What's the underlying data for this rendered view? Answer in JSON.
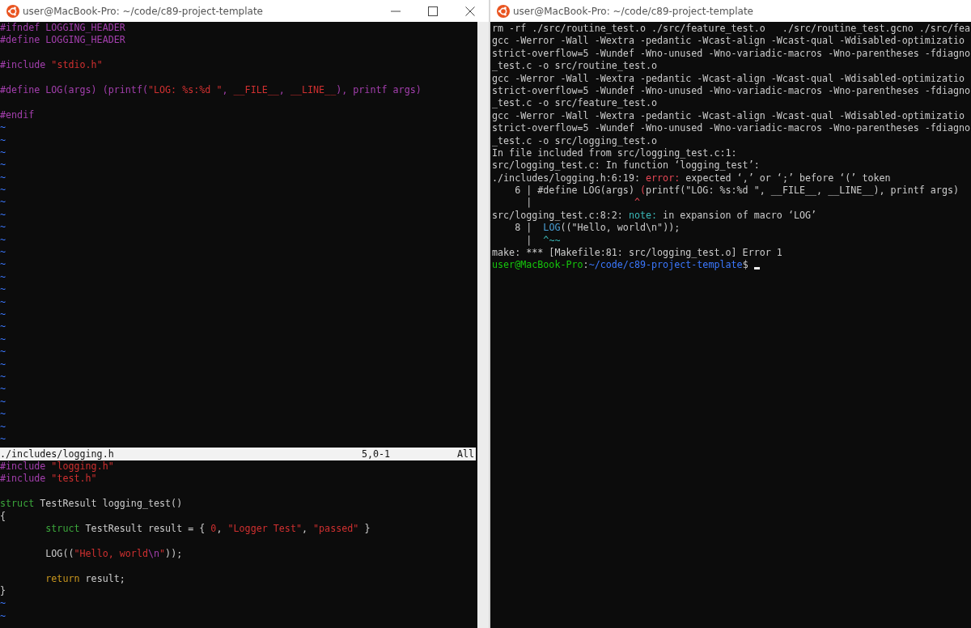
{
  "left_window": {
    "title": "user@MacBook-Pro: ~/code/c89-project-template",
    "controls": [
      {
        "kind": "minimize"
      },
      {
        "kind": "maximize"
      },
      {
        "kind": "close"
      }
    ],
    "vim": {
      "top_pane": {
        "lines": [
          {
            "kind": "code",
            "segments": [
              {
                "kind": "preproc",
                "text": "#ifndef LOGGING_HEADER"
              }
            ]
          },
          {
            "kind": "code",
            "segments": [
              {
                "kind": "preproc",
                "text": "#define LOGGING_HEADER"
              }
            ]
          },
          {
            "kind": "blank"
          },
          {
            "kind": "code",
            "segments": [
              {
                "kind": "preproc",
                "text": "#include "
              },
              {
                "kind": "string",
                "text": "\"stdio.h\""
              }
            ]
          },
          {
            "kind": "blank"
          },
          {
            "kind": "code",
            "segments": [
              {
                "kind": "preproc",
                "text": "#define LOG(args) (printf("
              },
              {
                "kind": "string",
                "text": "\"LOG: %s:%d \""
              },
              {
                "kind": "preproc",
                "text": ", "
              },
              {
                "kind": "string",
                "text": "__FILE__"
              },
              {
                "kind": "preproc",
                "text": ", "
              },
              {
                "kind": "string",
                "text": "__LINE__"
              },
              {
                "kind": "preproc",
                "text": "), printf args)"
              }
            ]
          },
          {
            "kind": "blank"
          },
          {
            "kind": "code",
            "segments": [
              {
                "kind": "preproc",
                "text": "#endif"
              }
            ]
          },
          {
            "kind": "tilde",
            "text": "~"
          },
          {
            "kind": "tilde",
            "text": "~"
          },
          {
            "kind": "tilde",
            "text": "~"
          },
          {
            "kind": "tilde",
            "text": "~"
          },
          {
            "kind": "tilde",
            "text": "~"
          },
          {
            "kind": "tilde",
            "text": "~"
          },
          {
            "kind": "tilde",
            "text": "~"
          },
          {
            "kind": "tilde",
            "text": "~"
          },
          {
            "kind": "tilde",
            "text": "~"
          },
          {
            "kind": "tilde",
            "text": "~"
          },
          {
            "kind": "tilde",
            "text": "~"
          },
          {
            "kind": "tilde",
            "text": "~"
          },
          {
            "kind": "tilde",
            "text": "~"
          },
          {
            "kind": "tilde",
            "text": "~"
          },
          {
            "kind": "tilde",
            "text": "~"
          },
          {
            "kind": "tilde",
            "text": "~"
          },
          {
            "kind": "tilde",
            "text": "~"
          },
          {
            "kind": "tilde",
            "text": "~"
          },
          {
            "kind": "tilde",
            "text": "~"
          },
          {
            "kind": "tilde",
            "text": "~"
          },
          {
            "kind": "tilde",
            "text": "~"
          },
          {
            "kind": "tilde",
            "text": "~"
          },
          {
            "kind": "tilde",
            "text": "~"
          },
          {
            "kind": "tilde",
            "text": "~"
          },
          {
            "kind": "tilde",
            "text": "~"
          },
          {
            "kind": "tilde",
            "text": "~"
          }
        ]
      },
      "status_line": {
        "file": "./includes/logging.h",
        "position": "5,0-1",
        "scroll": "All"
      },
      "bottom_pane": {
        "lines": [
          {
            "kind": "code",
            "segments": [
              {
                "kind": "preproc",
                "text": "#include "
              },
              {
                "kind": "string",
                "text": "\"logging.h\""
              }
            ]
          },
          {
            "kind": "code",
            "segments": [
              {
                "kind": "preproc",
                "text": "#include "
              },
              {
                "kind": "string",
                "text": "\"test.h\""
              }
            ]
          },
          {
            "kind": "blank"
          },
          {
            "kind": "code",
            "segments": [
              {
                "kind": "type",
                "text": "struct"
              },
              {
                "kind": "plain",
                "text": " TestResult logging_test()"
              }
            ]
          },
          {
            "kind": "code",
            "segments": [
              {
                "kind": "plain",
                "text": "{"
              }
            ]
          },
          {
            "kind": "code",
            "segments": [
              {
                "kind": "type",
                "text": "        struct"
              },
              {
                "kind": "plain",
                "text": " TestResult result = { "
              },
              {
                "kind": "string",
                "text": "0"
              },
              {
                "kind": "plain",
                "text": ", "
              },
              {
                "kind": "string",
                "text": "\"Logger Test\""
              },
              {
                "kind": "plain",
                "text": ", "
              },
              {
                "kind": "string",
                "text": "\"passed\""
              },
              {
                "kind": "plain",
                "text": " }"
              }
            ]
          },
          {
            "kind": "blank"
          },
          {
            "kind": "code",
            "segments": [
              {
                "kind": "plain",
                "text": "        LOG(("
              },
              {
                "kind": "string",
                "text": "\"Hello, world"
              },
              {
                "kind": "preproc",
                "text": "\\n"
              },
              {
                "kind": "string",
                "text": "\""
              },
              {
                "kind": "plain",
                "text": "));"
              }
            ]
          },
          {
            "kind": "blank"
          },
          {
            "kind": "code",
            "segments": [
              {
                "kind": "statement",
                "text": "        return"
              },
              {
                "kind": "plain",
                "text": " result;"
              }
            ]
          },
          {
            "kind": "code",
            "segments": [
              {
                "kind": "plain",
                "text": "}"
              }
            ]
          },
          {
            "kind": "tilde",
            "text": "~"
          },
          {
            "kind": "tilde",
            "text": "~"
          }
        ]
      }
    }
  },
  "right_window": {
    "title": "user@MacBook-Pro: ~/code/c89-project-template",
    "terminal": {
      "lines": [
        {
          "kind": "code",
          "segments": [
            {
              "kind": "plain",
              "text": "rm -rf ./src/routine_test.o ./src/feature_test.o   ./src/routine_test.gcno ./src/fea"
            }
          ]
        },
        {
          "kind": "code",
          "segments": [
            {
              "kind": "plain",
              "text": "gcc -Werror -Wall -Wextra -pedantic -Wcast-align -Wcast-qual -Wdisabled-optimizatio"
            }
          ]
        },
        {
          "kind": "code",
          "segments": [
            {
              "kind": "plain",
              "text": "strict-overflow=5 -Wundef -Wno-unused -Wno-variadic-macros -Wno-parentheses -fdiagno"
            }
          ]
        },
        {
          "kind": "code",
          "segments": [
            {
              "kind": "plain",
              "text": "_test.c -o src/routine_test.o"
            }
          ]
        },
        {
          "kind": "code",
          "segments": [
            {
              "kind": "plain",
              "text": "gcc -Werror -Wall -Wextra -pedantic -Wcast-align -Wcast-qual -Wdisabled-optimizatio"
            }
          ]
        },
        {
          "kind": "code",
          "segments": [
            {
              "kind": "plain",
              "text": "strict-overflow=5 -Wundef -Wno-unused -Wno-variadic-macros -Wno-parentheses -fdiagno"
            }
          ]
        },
        {
          "kind": "code",
          "segments": [
            {
              "kind": "plain",
              "text": "_test.c -o src/feature_test.o"
            }
          ]
        },
        {
          "kind": "code",
          "segments": [
            {
              "kind": "plain",
              "text": "gcc -Werror -Wall -Wextra -pedantic -Wcast-align -Wcast-qual -Wdisabled-optimizatio"
            }
          ]
        },
        {
          "kind": "code",
          "segments": [
            {
              "kind": "plain",
              "text": "strict-overflow=5 -Wundef -Wno-unused -Wno-variadic-macros -Wno-parentheses -fdiagno"
            }
          ]
        },
        {
          "kind": "code",
          "segments": [
            {
              "kind": "plain",
              "text": "_test.c -o src/logging_test.o"
            }
          ]
        },
        {
          "kind": "code",
          "segments": [
            {
              "kind": "plain",
              "text": "In file included from src/logging_test.c:1:"
            }
          ]
        },
        {
          "kind": "code",
          "segments": [
            {
              "kind": "plain",
              "text": "src/logging_test.c: In function ‘logging_test’:"
            }
          ]
        },
        {
          "kind": "code",
          "segments": [
            {
              "kind": "plain",
              "text": "./includes/logging.h:6:19: "
            },
            {
              "kind": "error",
              "text": "error:"
            },
            {
              "kind": "plain",
              "text": " expected ‘,’ or ‘;’ before ‘(’ token"
            }
          ]
        },
        {
          "kind": "code",
          "segments": [
            {
              "kind": "plain",
              "text": "    6 | #define LOG(args) "
            },
            {
              "kind": "error",
              "text": "("
            },
            {
              "kind": "plain",
              "text": "printf(\"LOG: %s:%d \", __FILE__, __LINE__), printf args)"
            }
          ]
        },
        {
          "kind": "code",
          "segments": [
            {
              "kind": "plain",
              "text": "      |                  "
            },
            {
              "kind": "error",
              "text": "^"
            }
          ]
        },
        {
          "kind": "code",
          "segments": [
            {
              "kind": "plain",
              "text": "src/logging_test.c:8:2: "
            },
            {
              "kind": "note",
              "text": "note:"
            },
            {
              "kind": "plain",
              "text": " in expansion of macro ‘LOG’"
            }
          ]
        },
        {
          "kind": "code",
          "segments": [
            {
              "kind": "plain",
              "text": "    8 |  "
            },
            {
              "kind": "macro",
              "text": "LOG"
            },
            {
              "kind": "plain",
              "text": "((\"Hello, world\\n\"));"
            }
          ]
        },
        {
          "kind": "code",
          "segments": [
            {
              "kind": "plain",
              "text": "      |  "
            },
            {
              "kind": "note",
              "text": "^~~"
            }
          ]
        },
        {
          "kind": "code",
          "segments": [
            {
              "kind": "plain",
              "text": "make: *** [Makefile:81: src/logging_test.o] Error 1"
            }
          ]
        },
        {
          "kind": "code",
          "segments": [
            {
              "kind": "user",
              "text": "user@MacBook-Pro"
            },
            {
              "kind": "plain",
              "text": ":"
            },
            {
              "kind": "path",
              "text": "~/code/c89-project-template"
            },
            {
              "kind": "plain",
              "text": "$ "
            },
            {
              "kind": "cursor"
            }
          ]
        }
      ]
    }
  }
}
